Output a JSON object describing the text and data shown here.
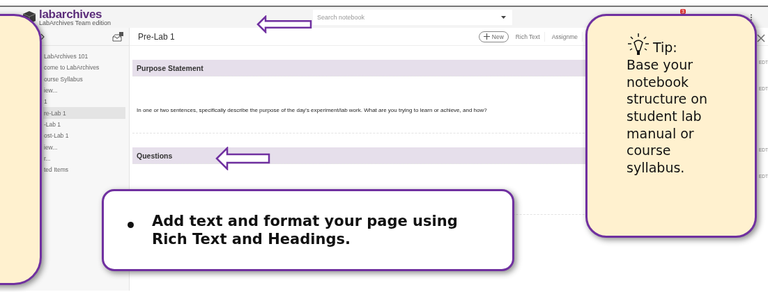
{
  "header": {
    "brand": "labarchives",
    "edition": "LabArchives Team edition",
    "search": {
      "placeholder": "Search notebook"
    },
    "notification_count": "3"
  },
  "sidebar": {
    "items": [
      {
        "label": "LabArchives 101",
        "selected": false
      },
      {
        "label": "come to LabArchives",
        "selected": false
      },
      {
        "label": "ourse Syllabus",
        "selected": false
      },
      {
        "label": "iew...",
        "selected": false
      },
      {
        "label": "1",
        "selected": false
      },
      {
        "label": "re-Lab 1",
        "selected": true
      },
      {
        "label": "-Lab 1",
        "selected": false
      },
      {
        "label": "ost-Lab 1",
        "selected": false
      },
      {
        "label": "iew...",
        "selected": false
      },
      {
        "label": "r...",
        "selected": false
      },
      {
        "label": "ted Items",
        "selected": false
      }
    ]
  },
  "page": {
    "title": "Pre-Lab 1",
    "toolbar": [
      "New",
      "Rich Text",
      "Assignme"
    ],
    "entries": [
      {
        "kind": "heading",
        "text": "Purpose Statement",
        "tag": "EDT"
      },
      {
        "kind": "text",
        "text": "In one or two sentences, specifically describe the purpose of the day's experiment/lab work. What are you trying to learn or achieve, and how?",
        "tag": "EDT"
      },
      {
        "kind": "heading",
        "text": "Questions",
        "tag": "EDT"
      },
      {
        "kind": "text",
        "tag": "EDT"
      }
    ]
  },
  "callouts": {
    "tip": {
      "title": "Tip:",
      "text": "Base your notebook structure on student lab manual or course syllabus."
    },
    "bullet": "Add text and format your page using Rich Text and Headings."
  }
}
